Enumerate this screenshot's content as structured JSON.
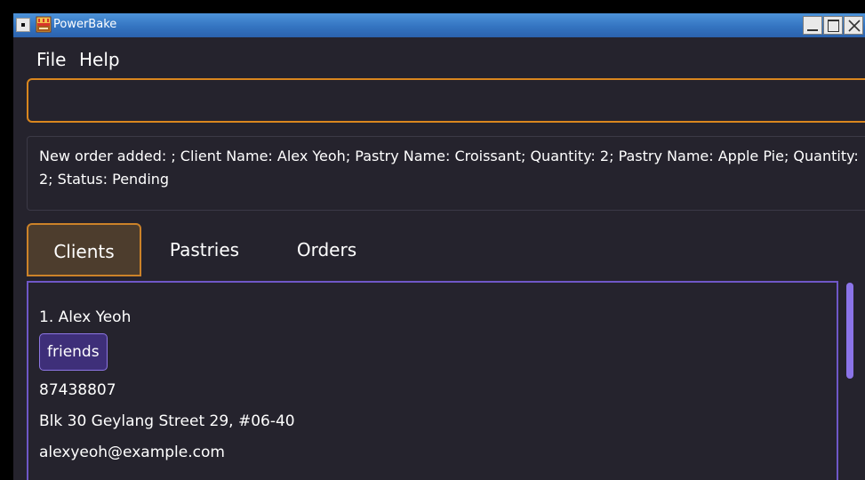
{
  "window": {
    "title": "PowerBake"
  },
  "menu": {
    "file": "File",
    "help": "Help"
  },
  "command": {
    "value": "",
    "placeholder": ""
  },
  "result": {
    "message": "New order added: ; Client Name: Alex Yeoh; Pastry Name: Croissant; Quantity: 2; Pastry Name: Apple Pie; Quantity: 2; Status: Pending"
  },
  "tabs": [
    {
      "label": "Clients",
      "selected": true
    },
    {
      "label": "Pastries",
      "selected": false
    },
    {
      "label": "Orders",
      "selected": false
    }
  ],
  "clients": [
    {
      "name": "1. Alex Yeoh",
      "tags": [
        "friends"
      ],
      "phone": "87438807",
      "address": "Blk 30 Geylang Street 29, #06-40",
      "email": "alexyeoh@example.com"
    }
  ],
  "colors": {
    "background": "#25232d",
    "accent_orange": "#d9861e",
    "accent_purple": "#6f57c7",
    "tag_fill": "#3e2f79"
  },
  "icons": {
    "app": "cake-icon",
    "system_menu": "window-menu-icon",
    "minimize": "minimize-icon",
    "maximize": "maximize-icon",
    "close": "close-icon"
  }
}
